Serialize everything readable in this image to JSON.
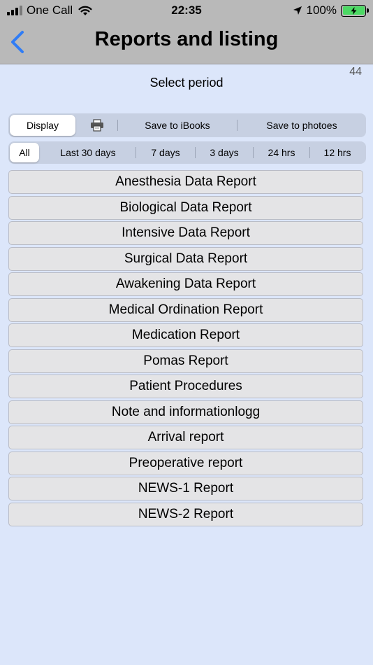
{
  "status_bar": {
    "carrier": "One Call",
    "time": "22:35",
    "battery": "100%"
  },
  "nav": {
    "title": "Reports and listing",
    "back_icon": "chevron-left-icon",
    "accent": "#2f7cf6"
  },
  "counter": "44",
  "period_label": "Select period",
  "actions": {
    "display": "Display",
    "print_icon": "printer-icon",
    "save_ibooks": "Save to iBooks",
    "save_photos": "Save to photoes"
  },
  "periods": {
    "all": "All",
    "last30": "Last 30 days",
    "d7": "7 days",
    "d3": "3 days",
    "h24": "24 hrs",
    "h12": "12 hrs"
  },
  "reports": [
    "Anesthesia Data Report",
    "Biological Data Report",
    "Intensive Data Report",
    "Surgical Data Report",
    "Awakening Data Report",
    "Medical Ordination Report",
    "Medication Report",
    "Pomas Report",
    "Patient Procedures",
    "Note and informationlogg",
    "Arrival report",
    "Preoperative report",
    "NEWS-1 Report",
    "NEWS-2 Report"
  ]
}
